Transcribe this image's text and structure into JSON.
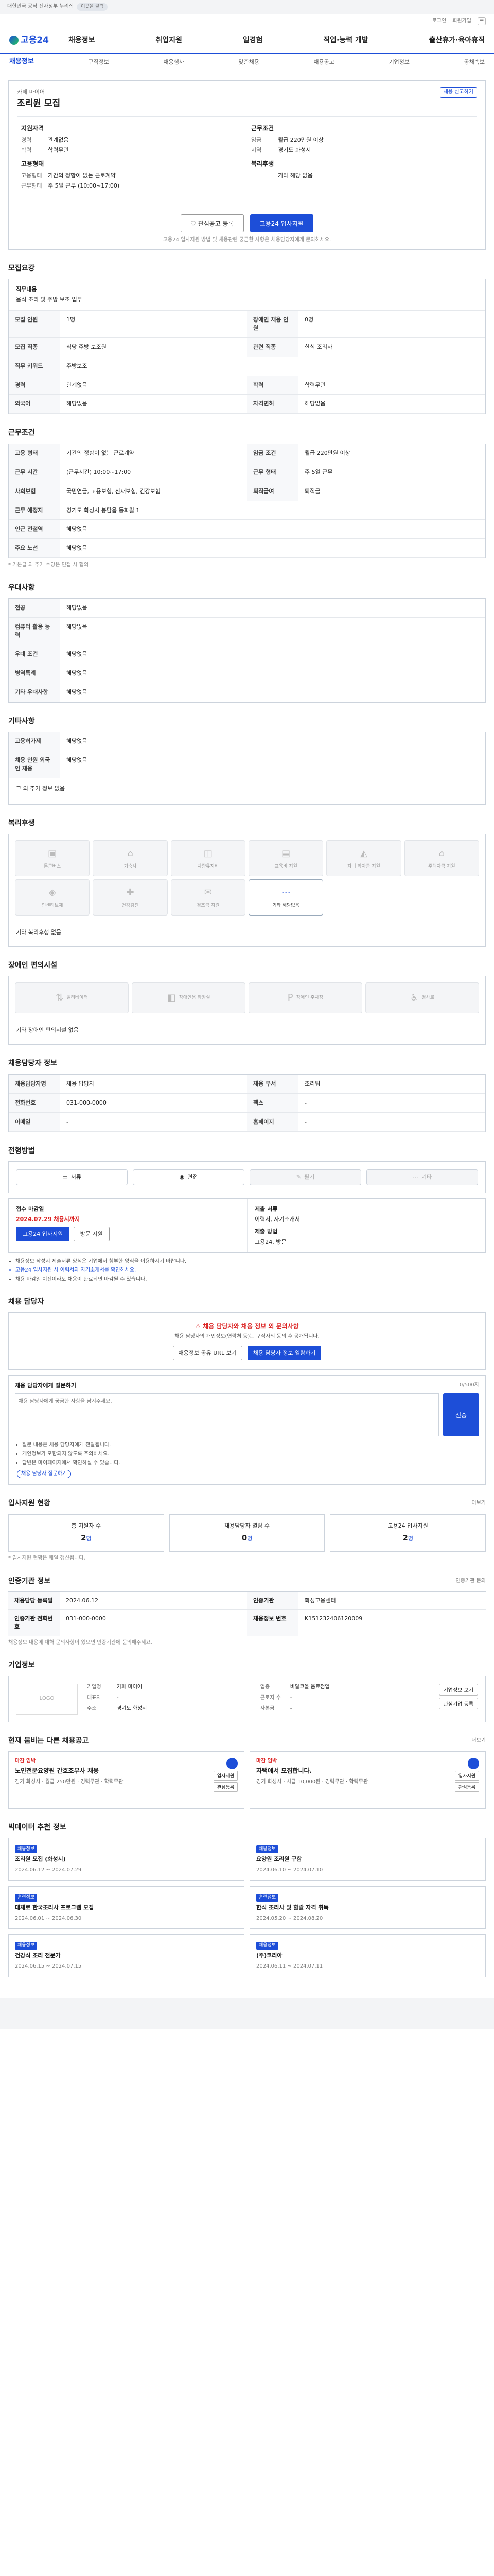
{
  "topbar": {
    "text": "대한민국 공식 전자정부 누리집",
    "pill": "이곳을 클릭"
  },
  "util": {
    "login": "로그인",
    "join": "회원가입",
    "menu": "메뉴"
  },
  "gnb": {
    "logo": "고용24",
    "menu": [
      "채용정보",
      "취업지원",
      "일경험",
      "직업·능력 개발",
      "출산휴가·육아휴직"
    ]
  },
  "subnav": {
    "items": [
      "채용정보",
      "구직정보",
      "채용행사",
      "맞춤채용",
      "채용공고",
      "기업정보",
      "공채속보"
    ]
  },
  "job": {
    "company": "카페 마이어",
    "title": "조리원 모집",
    "report": "채용 신고하기",
    "left_head_1": "지원자격",
    "left_rows_1": [
      {
        "k": "경력",
        "v": "관계없음"
      },
      {
        "k": "학력",
        "v": "학력무관"
      }
    ],
    "left_head_2": "고용형태",
    "left_rows_2": [
      {
        "k": "고용형태",
        "v": "기간의 정함이 없는 근로계약"
      },
      {
        "k": "근무형태",
        "v": "주 5일 근무 (10:00~17:00)"
      }
    ],
    "right_head_1": "근무조건",
    "right_rows_1": [
      {
        "k": "임금",
        "v": "월급 220만원 이상"
      },
      {
        "k": "지역",
        "v": "경기도 화성시"
      }
    ],
    "right_head_2": "복리후생",
    "right_rows_2": [
      {
        "k": "",
        "v": "기타 해당 없음"
      }
    ],
    "btn_interest": "관심공고 등록",
    "btn_apply": "고용24 입사지원",
    "note": "고용24 입사지원 방법 및 채용관련 궁금한 사항은 채용담당자에게 문의하세요."
  },
  "recruit": {
    "title": "모집요강",
    "job_content_label": "직무내용",
    "job_content": "음식 조리 및 주방 보조 업무",
    "rows": [
      [
        "모집 인원",
        "1명",
        "장애인 채용 인원",
        "0명"
      ],
      [
        "모집 직종",
        "식당 주방 보조원",
        "관련 직종",
        "한식 조리사"
      ],
      [
        "직무 키워드",
        "주방보조",
        "",
        ""
      ],
      [
        "경력",
        "관계없음",
        "학력",
        "학력무관"
      ],
      [
        "외국어",
        "해당없음",
        "자격면허",
        "해당없음"
      ]
    ]
  },
  "cond": {
    "title": "근무조건",
    "rows": [
      [
        "고용 형태",
        "기간의 정함이 없는 근로계약",
        "임금 조건",
        "월급 220만원 이상"
      ],
      [
        "근무 시간",
        "(근무시간) 10:00~17:00",
        "근무 형태",
        "주 5일 근무"
      ],
      [
        "사회보험",
        "국민연금, 고용보험, 산재보험, 건강보험",
        "퇴직급여",
        "퇴직금"
      ],
      [
        "근무 예정지",
        "경기도 화성시 봉담읍 동화길 1",
        "",
        ""
      ],
      [
        "인근 전철역",
        "해당없음",
        "",
        ""
      ],
      [
        "주요 노선",
        "해당없음",
        "",
        ""
      ]
    ],
    "note": "* 기본급 외 추가 수당은 면접 시 협의"
  },
  "prefer": {
    "title": "우대사항",
    "rows": [
      [
        "전공",
        "해당없음"
      ],
      [
        "컴퓨터 활용 능력",
        "해당없음"
      ],
      [
        "우대 조건",
        "해당없음"
      ],
      [
        "병역특례",
        "해당없음"
      ],
      [
        "기타 우대사항",
        "해당없음"
      ]
    ]
  },
  "etc": {
    "title": "기타사항",
    "rows": [
      [
        "고용허가제",
        "해당없음"
      ],
      [
        "채용 인원 외국인 채용",
        "해당없음"
      ]
    ],
    "box": "그 외 추가 정보 없음"
  },
  "benefits": {
    "title": "복리후생",
    "items": [
      "통근버스",
      "기숙사",
      "차량유지비",
      "교육비 지원",
      "자녀 학자금 지원",
      "주택자금 지원",
      "인센티브제",
      "건강검진",
      "경조금 지원",
      "기타 해당없음"
    ],
    "note": "기타 복리후생 없음"
  },
  "disability": {
    "title": "장애인 편의시설",
    "items": [
      "엘리베이터",
      "장애인용 화장실",
      "장애인 주차장",
      "경사로"
    ],
    "note": "기타 장애인 편의시설 없음"
  },
  "manager": {
    "title": "채용담당자 정보",
    "rows": [
      [
        "채용담당자명",
        "채용 담당자",
        "채용 부서",
        "조리팀"
      ],
      [
        "전화번호",
        "031-000-0000",
        "팩스",
        "-"
      ],
      [
        "이메일",
        "-",
        "홈페이지",
        "-"
      ]
    ]
  },
  "method": {
    "title": "전형방법",
    "items": [
      "서류",
      "면접",
      "필기",
      "기타"
    ],
    "apply_head": "접수 마감일",
    "apply_deadline": "2024.07.29 채용시까지",
    "apply_btn": "고용24 입사지원",
    "apply_btn2": "방문 지원",
    "doc_head": "제출 서류",
    "doc_text": "이력서, 자기소개서",
    "submit_head": "제출 방법",
    "submit_text": "고용24, 방문",
    "bullets": [
      "채용정보 작성시 제출서류 양식은 기업에서 첨부한 양식을 이용하시기 바랍니다.",
      "고용24 입사지원 시 이력서와 자기소개서를 확인하세요.",
      "채용 마감일 이전이라도 채용이 완료되면 마감될 수 있습니다."
    ]
  },
  "contact": {
    "title": "채용 담당자",
    "head": "채용 담당자와 채용 정보 외 문의사항",
    "text": "채용 담당자의 개인정보(연락처 등)는 구직자의 동의 후 공개됩니다.",
    "btn1": "채용정보 공유 URL 보기",
    "btn2": "채용 담당자 정보 열람하기"
  },
  "inquiry": {
    "title": "채용 담당자에게 질문하기",
    "sub": "0/500자",
    "placeholder": "채용 담당자에게 궁금한 사항을 남겨주세요.",
    "send": "전송",
    "notes": [
      "질문 내용은 채용 담당자에게 전달됩니다.",
      "개인정보가 포함되지 않도록 주의하세요.",
      "답변은 마이페이지에서 확인하실 수 있습니다."
    ],
    "link": "채용 담당자 질문하기"
  },
  "stats": {
    "title": "입사지원 현황",
    "more": "더보기",
    "items": [
      {
        "label": "총 지원자 수",
        "value": "2",
        "unit": "명"
      },
      {
        "label": "채용담당자 열람 수",
        "value": "0",
        "unit": "명"
      },
      {
        "label": "고용24 입사지원",
        "value": "2",
        "unit": "명"
      }
    ],
    "note": "* 입사지원 현황은 매일 갱신됩니다."
  },
  "mgmt": {
    "title": "인증기관 정보",
    "btn": "인증기관 문의",
    "rows": [
      [
        "채용담당 등록일",
        "2024.06.12",
        "인증기관",
        "화성고용센터"
      ],
      [
        "인증기관 전화번호",
        "031-000-0000",
        "채용정보 번호",
        "K151232406120009"
      ]
    ],
    "note": "채용정보 내용에 대해 문의사항이 있으면 인증기관에 문의해주세요."
  },
  "corp": {
    "title": "기업정보",
    "logo": "LOGO",
    "rows": [
      [
        "기업명",
        "카페 마이어"
      ],
      [
        "업종",
        "비알코올 음료점업"
      ],
      [
        "대표자",
        "-"
      ],
      [
        "근로자 수",
        "-"
      ],
      [
        "주소",
        "경기도 화성시"
      ],
      [
        "자본금",
        "-"
      ]
    ],
    "btns": [
      "기업정보 보기",
      "관심기업 등록"
    ]
  },
  "recs": {
    "title": "현재 붐비는 다른 채용공고",
    "more": "더보기",
    "items": [
      {
        "badge": "마감 임박",
        "title": "노인전문요양원 간호조무사 채용",
        "meta": "경기 화성시 · 월급 250만원 · 경력무관 · 학력무관",
        "btn1": "입사지원",
        "btn2": "관심등록"
      },
      {
        "badge": "마감 임박",
        "title": "자택에서 모집합니다.",
        "meta": "경기 화성시 · 시급 10,000원 · 경력무관 · 학력무관",
        "btn1": "입사지원",
        "btn2": "관심등록"
      }
    ]
  },
  "promo": {
    "title": "빅데이터 추천 정보",
    "items": [
      {
        "badge": "채용정보",
        "title": "조리원 모집 (화성시)",
        "meta": "2024.06.12 ~ 2024.07.29"
      },
      {
        "badge": "채용정보",
        "title": "요양원 조리원 구함",
        "meta": "2024.06.10 ~ 2024.07.10"
      },
      {
        "badge": "훈련정보",
        "title": "대체로 한국조리사 프로그램 모집",
        "meta": "2024.06.01 ~ 2024.06.30"
      },
      {
        "badge": "훈련정보",
        "title": "한식 조리사 및 할랄 자격 취득",
        "meta": "2024.05.20 ~ 2024.08.20"
      },
      {
        "badge": "채용정보",
        "title": "건강식 조리 전문가",
        "meta": "2024.06.15 ~ 2024.07.15"
      },
      {
        "badge": "채용정보",
        "title": "(주)코리아",
        "meta": "2024.06.11 ~ 2024.07.11"
      }
    ]
  }
}
